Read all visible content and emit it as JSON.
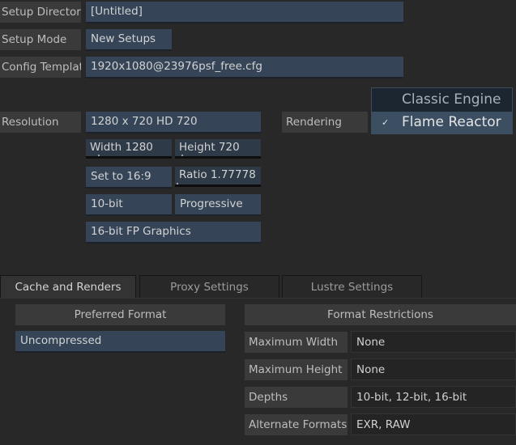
{
  "setup": {
    "directory_label": "Setup Directory",
    "directory_value": "[Untitled]",
    "mode_label": "Setup Mode",
    "mode_value": "New Setups",
    "template_label": "Config Template",
    "template_value": "1920x1080@23976psf_free.cfg"
  },
  "resolution": {
    "label": "Resolution",
    "preset": "1280 x 720 HD 720",
    "width": "Width 1280",
    "height": "Height 720",
    "set_aspect": "Set to 16:9",
    "ratio": "Ratio 1.77778",
    "bit_depth": "10-bit",
    "scan_mode": "Progressive",
    "graphics": "16-bit FP Graphics"
  },
  "rendering": {
    "label": "Rendering",
    "options": [
      {
        "label": "Classic Engine",
        "selected": false
      },
      {
        "label": "Flame Reactor",
        "selected": true
      }
    ],
    "check_glyph": "✓"
  },
  "tabs": [
    {
      "label": "Cache and Renders",
      "active": true
    },
    {
      "label": "Proxy Settings",
      "active": false
    },
    {
      "label": "Lustre Settings",
      "active": false
    }
  ],
  "cache": {
    "preferred_header": "Preferred Format",
    "preferred_value": "Uncompressed",
    "restrictions_header": "Format Restrictions",
    "rows": [
      {
        "label": "Maximum Width",
        "value": "None"
      },
      {
        "label": "Maximum Height",
        "value": "None"
      },
      {
        "label": "Depths",
        "value": "10-bit, 12-bit, 16-bit"
      },
      {
        "label": "Alternate Formats",
        "value": "EXR, RAW"
      }
    ]
  }
}
